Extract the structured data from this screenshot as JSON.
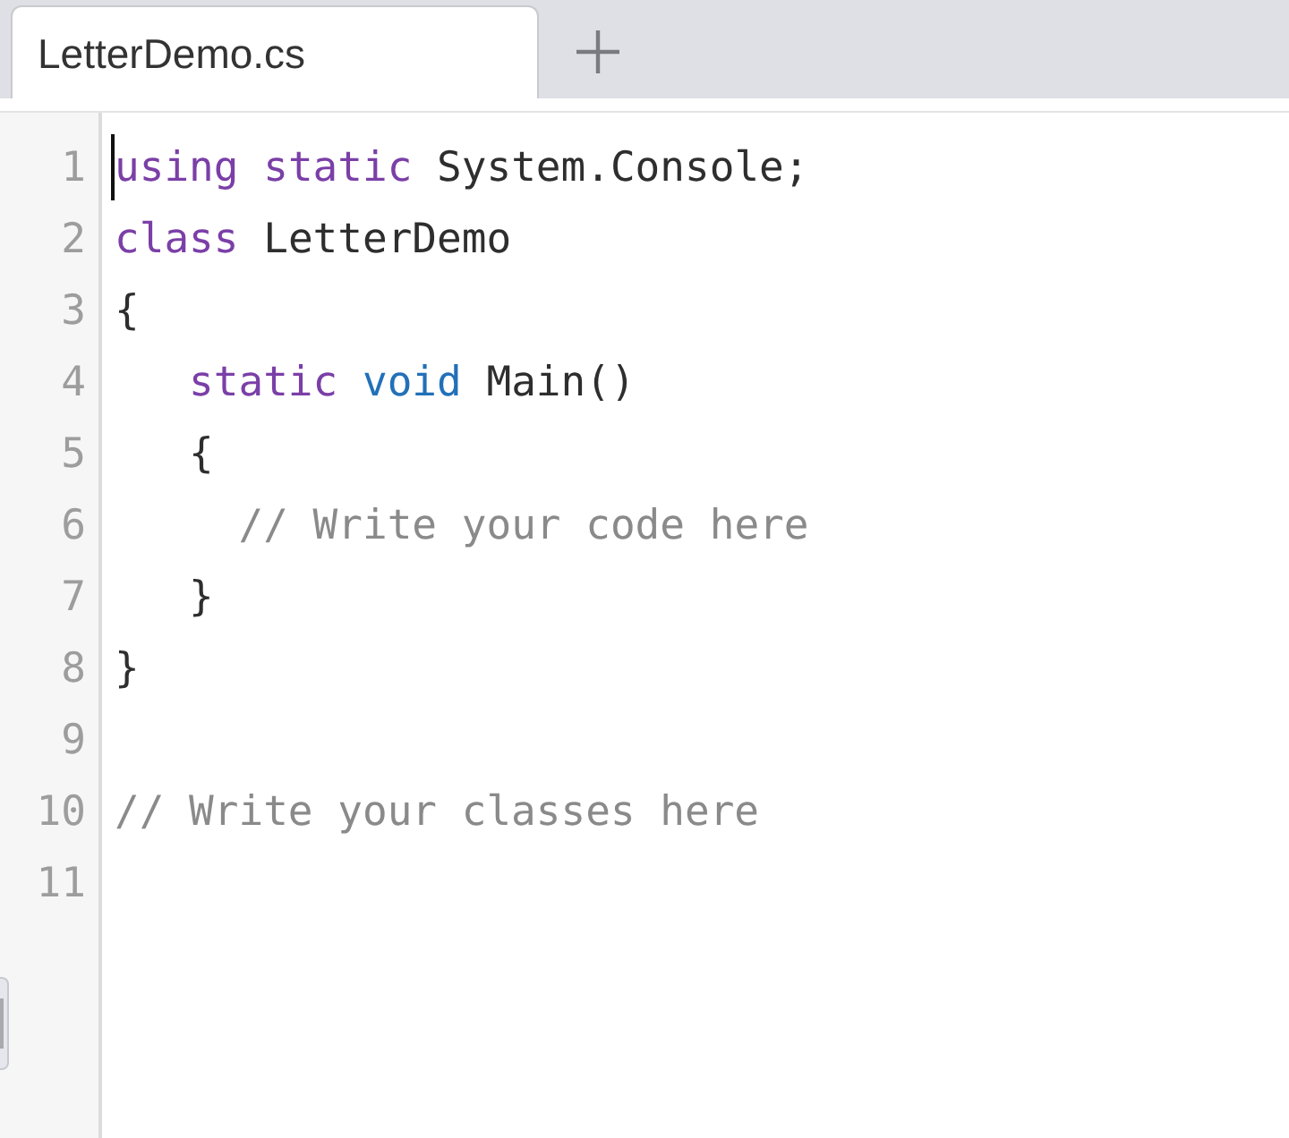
{
  "tabs": [
    {
      "label": "LetterDemo.cs",
      "selected": true
    }
  ],
  "editor": {
    "lines": [
      {
        "number": "1",
        "cursor": true,
        "tokens": [
          {
            "text": "using",
            "kind": "keyword"
          },
          {
            "text": " static",
            "kind": "keyword"
          },
          {
            "text": " System.Console;",
            "kind": "plain"
          }
        ]
      },
      {
        "number": "2",
        "cursor": false,
        "tokens": [
          {
            "text": "class",
            "kind": "keyword"
          },
          {
            "text": " LetterDemo",
            "kind": "plain"
          }
        ]
      },
      {
        "number": "3",
        "cursor": false,
        "tokens": [
          {
            "text": "{",
            "kind": "plain"
          }
        ]
      },
      {
        "number": "4",
        "cursor": false,
        "tokens": [
          {
            "text": "   static",
            "kind": "keyword"
          },
          {
            "text": " void",
            "kind": "type"
          },
          {
            "text": " Main()",
            "kind": "plain"
          }
        ]
      },
      {
        "number": "5",
        "cursor": false,
        "tokens": [
          {
            "text": "   {",
            "kind": "plain"
          }
        ]
      },
      {
        "number": "6",
        "cursor": false,
        "tokens": [
          {
            "text": "     // Write your code here",
            "kind": "comment"
          }
        ]
      },
      {
        "number": "7",
        "cursor": false,
        "tokens": [
          {
            "text": "   }",
            "kind": "plain"
          }
        ]
      },
      {
        "number": "8",
        "cursor": false,
        "tokens": [
          {
            "text": "}",
            "kind": "plain"
          }
        ]
      },
      {
        "number": "9",
        "cursor": false
      },
      {
        "number": "10",
        "cursor": false,
        "tokens": [
          {
            "text": "// Write your classes here",
            "kind": "comment"
          }
        ]
      },
      {
        "number": "11",
        "cursor": false
      }
    ]
  }
}
